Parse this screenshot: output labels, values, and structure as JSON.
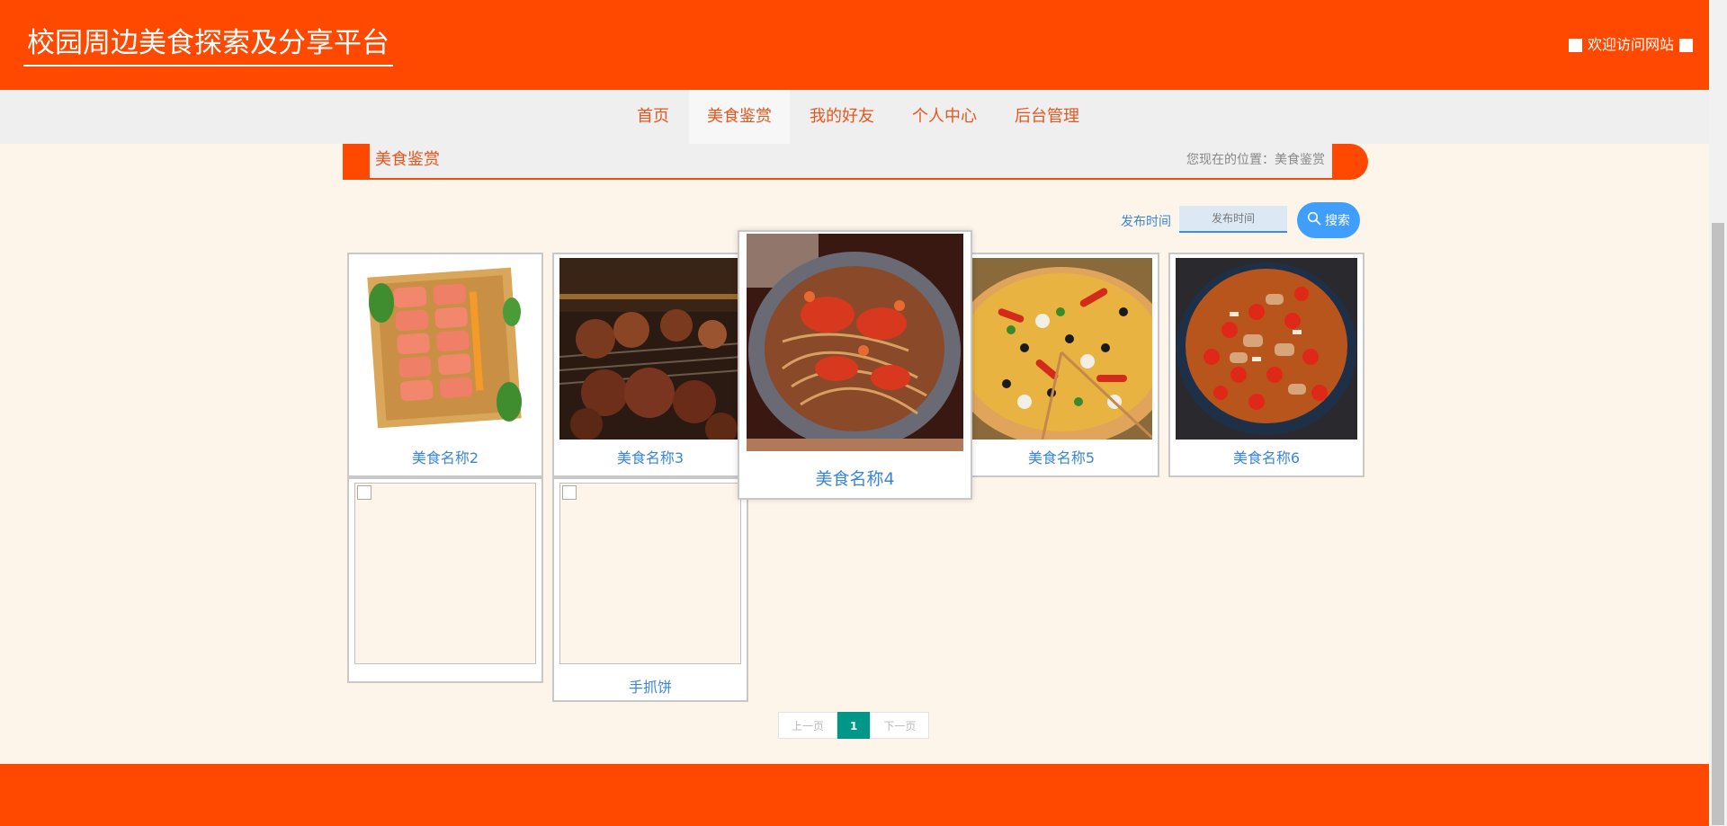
{
  "header": {
    "site_title": "校园周边美食探索及分享平台",
    "welcome": "欢迎访问网站"
  },
  "nav": {
    "items": [
      {
        "label": "首页",
        "active": false
      },
      {
        "label": "美食鉴赏",
        "active": true
      },
      {
        "label": "我的好友",
        "active": false
      },
      {
        "label": "个人中心",
        "active": false
      },
      {
        "label": "后台管理",
        "active": false
      }
    ]
  },
  "breadcrumb": {
    "title": "美食鉴赏",
    "location": "您现在的位置：美食鉴赏"
  },
  "search": {
    "label": "发布时间",
    "placeholder": "发布时间",
    "button": "搜索"
  },
  "foods": [
    {
      "name": "美食名称2",
      "image": "salmon-sashimi"
    },
    {
      "name": "美食名称3",
      "image": "bbq-skewers"
    },
    {
      "name": "美食名称4",
      "image": "crab-noodles",
      "hovered": true
    },
    {
      "name": "美食名称5",
      "image": "pizza"
    },
    {
      "name": "美食名称6",
      "image": "spicy-chicken"
    },
    {
      "name": "",
      "image": "broken"
    },
    {
      "name": "手抓饼",
      "image": "broken"
    }
  ],
  "pagination": {
    "prev": "上一页",
    "current": "1",
    "next": "下一页"
  },
  "colors": {
    "brand": "#ff4800",
    "nav_bg": "#efefef",
    "link": "#3a86d6",
    "page_bg": "#fdf4ea",
    "pager_active": "#009688",
    "search_btn": "#409eff"
  }
}
